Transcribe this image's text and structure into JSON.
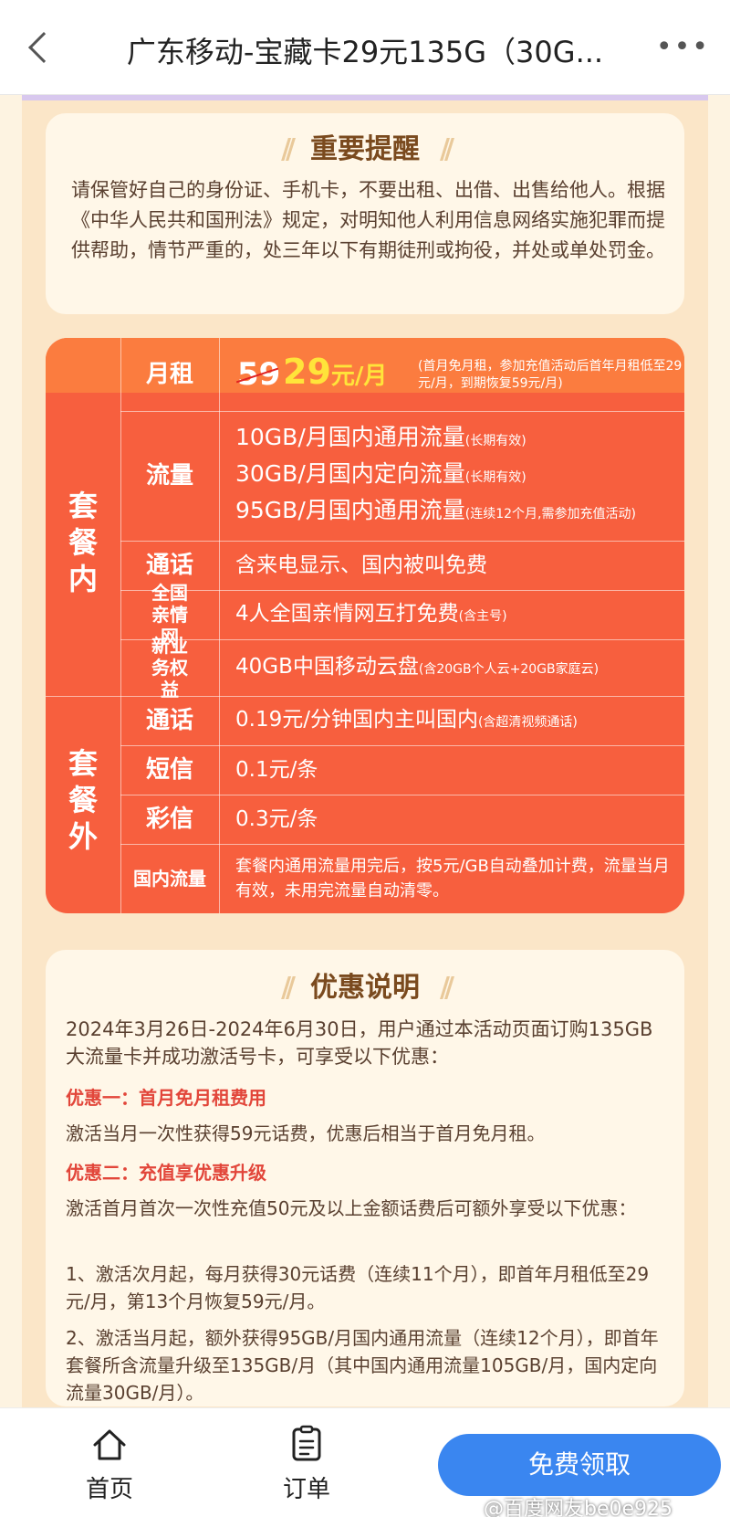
{
  "header": {
    "title": "广东移动-宝藏卡29元135G（30G...",
    "back_icon": "chevron-left-icon",
    "more_icon": "more-dots-icon",
    "more_glyph": "•••"
  },
  "reminder": {
    "title": "重要提醒",
    "text": "请保管好自己的身份证、手机卡，不要出租、出借、出售给他人。根据《中华人民共和国刑法》规定，对明知他人利用信息网络实施犯罪而提供帮助，情节严重的，处三年以下有期徒刑或拘役，并处或单处罚金。"
  },
  "package": {
    "inside_label": "套餐内",
    "outside_label": "套餐外",
    "rent": {
      "label": "月租",
      "old_price": "59",
      "new_price": "29",
      "unit": "元/月",
      "note": "(首月免月租，参加充值活动后首年月租低至29元/月，到期恢复59元/月)"
    },
    "data": {
      "label": "流量",
      "lines": [
        {
          "main": "10GB/月国内通用流量",
          "note": "(长期有效)"
        },
        {
          "main": "30GB/月国内定向流量",
          "note": "(长期有效)"
        },
        {
          "main": "95GB/月国内通用流量",
          "note": "(连续12个月,需参加充值活动)"
        }
      ]
    },
    "call": {
      "label": "通话",
      "value": "含来电显示、国内被叫免费"
    },
    "family": {
      "label": "全国亲情网",
      "value": "4人全国亲情网互打免费",
      "note": "(含主号)"
    },
    "benefit": {
      "label": "新业务权益",
      "value": "40GB中国移动云盘",
      "note": "(含20GB个人云+20GB家庭云)"
    },
    "extra_call": {
      "label": "通话",
      "value": "0.19元/分钟国内主叫国内",
      "note": "(含超清视频通话)"
    },
    "sms": {
      "label": "短信",
      "value": "0.1元/条"
    },
    "mms": {
      "label": "彩信",
      "value": "0.3元/条"
    },
    "domestic_data": {
      "label": "国内流量",
      "value": "套餐内通用流量用完后，按5元/GB自动叠加计费，流量当月有效，未用完流量自动清零。"
    }
  },
  "promo": {
    "title": "优惠说明",
    "period": "2024年3月26日-2024年6月30日，用户通过本活动页面订购135GB大流量卡并成功激活号卡，可享受以下优惠：",
    "offer1_title": "优惠一：首月免月租费用",
    "offer1_text": "激活当月一次性获得59元话费，优惠后相当于首月免月租。",
    "offer2_title": "优惠二：充值享优惠升级",
    "offer2_text": "激活首月首次一次性充值50元及以上金额话费后可额外享受以下优惠：",
    "item1": "1、激活次月起，每月获得30元话费（连续11个月），即首年月租低至29元/月，第13个月恢复59元/月。",
    "item2": "2、激活当月起，额外获得95GB/月国内通用流量（连续12个月），即首年套餐所含流量升级至135GB/月（其中国内通用流量105GB/月，国内定向流量30GB/月）。"
  },
  "bottom_nav": {
    "home_label": "首页",
    "order_label": "订单",
    "claim_label": "免费领取",
    "home_icon": "home-icon",
    "order_icon": "clipboard-icon"
  },
  "watermark": "@百度网友be0e925",
  "colors": {
    "package_bg": "#f75f3e",
    "price_highlight": "#ffe43a",
    "promo_subtitle": "#e2463a",
    "claim_button": "#3a86f0"
  }
}
